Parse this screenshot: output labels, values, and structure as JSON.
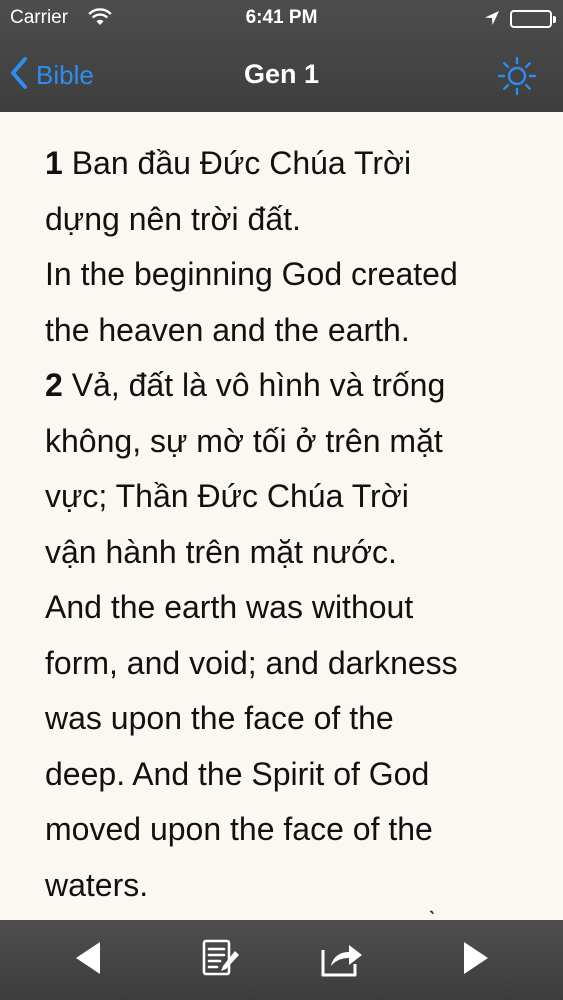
{
  "status_bar": {
    "carrier": "Carrier",
    "time": "6:41 PM"
  },
  "nav": {
    "back_label": "Bible",
    "title": "Gen 1"
  },
  "verses": [
    {
      "number": "1",
      "lines": [
        "Ban đầu Đức Chúa Trời",
        "dựng nên trời đất.",
        "In the beginning God created",
        "the heaven and the earth."
      ]
    },
    {
      "number": "2",
      "lines": [
        "Vả, đất là vô hình và trống",
        "không, sự mờ tối ở trên mặt",
        "vực; Thần Đức Chúa Trời",
        "vận hành trên mặt nước.",
        "And the earth was without",
        "form, and void; and darkness",
        "was upon the face of the",
        "deep. And the Spirit of God",
        "moved upon the face of the",
        "waters."
      ]
    }
  ],
  "colors": {
    "accent": "#2c8ef0",
    "bar": "#444444",
    "page_background": "#fbf8f1"
  }
}
